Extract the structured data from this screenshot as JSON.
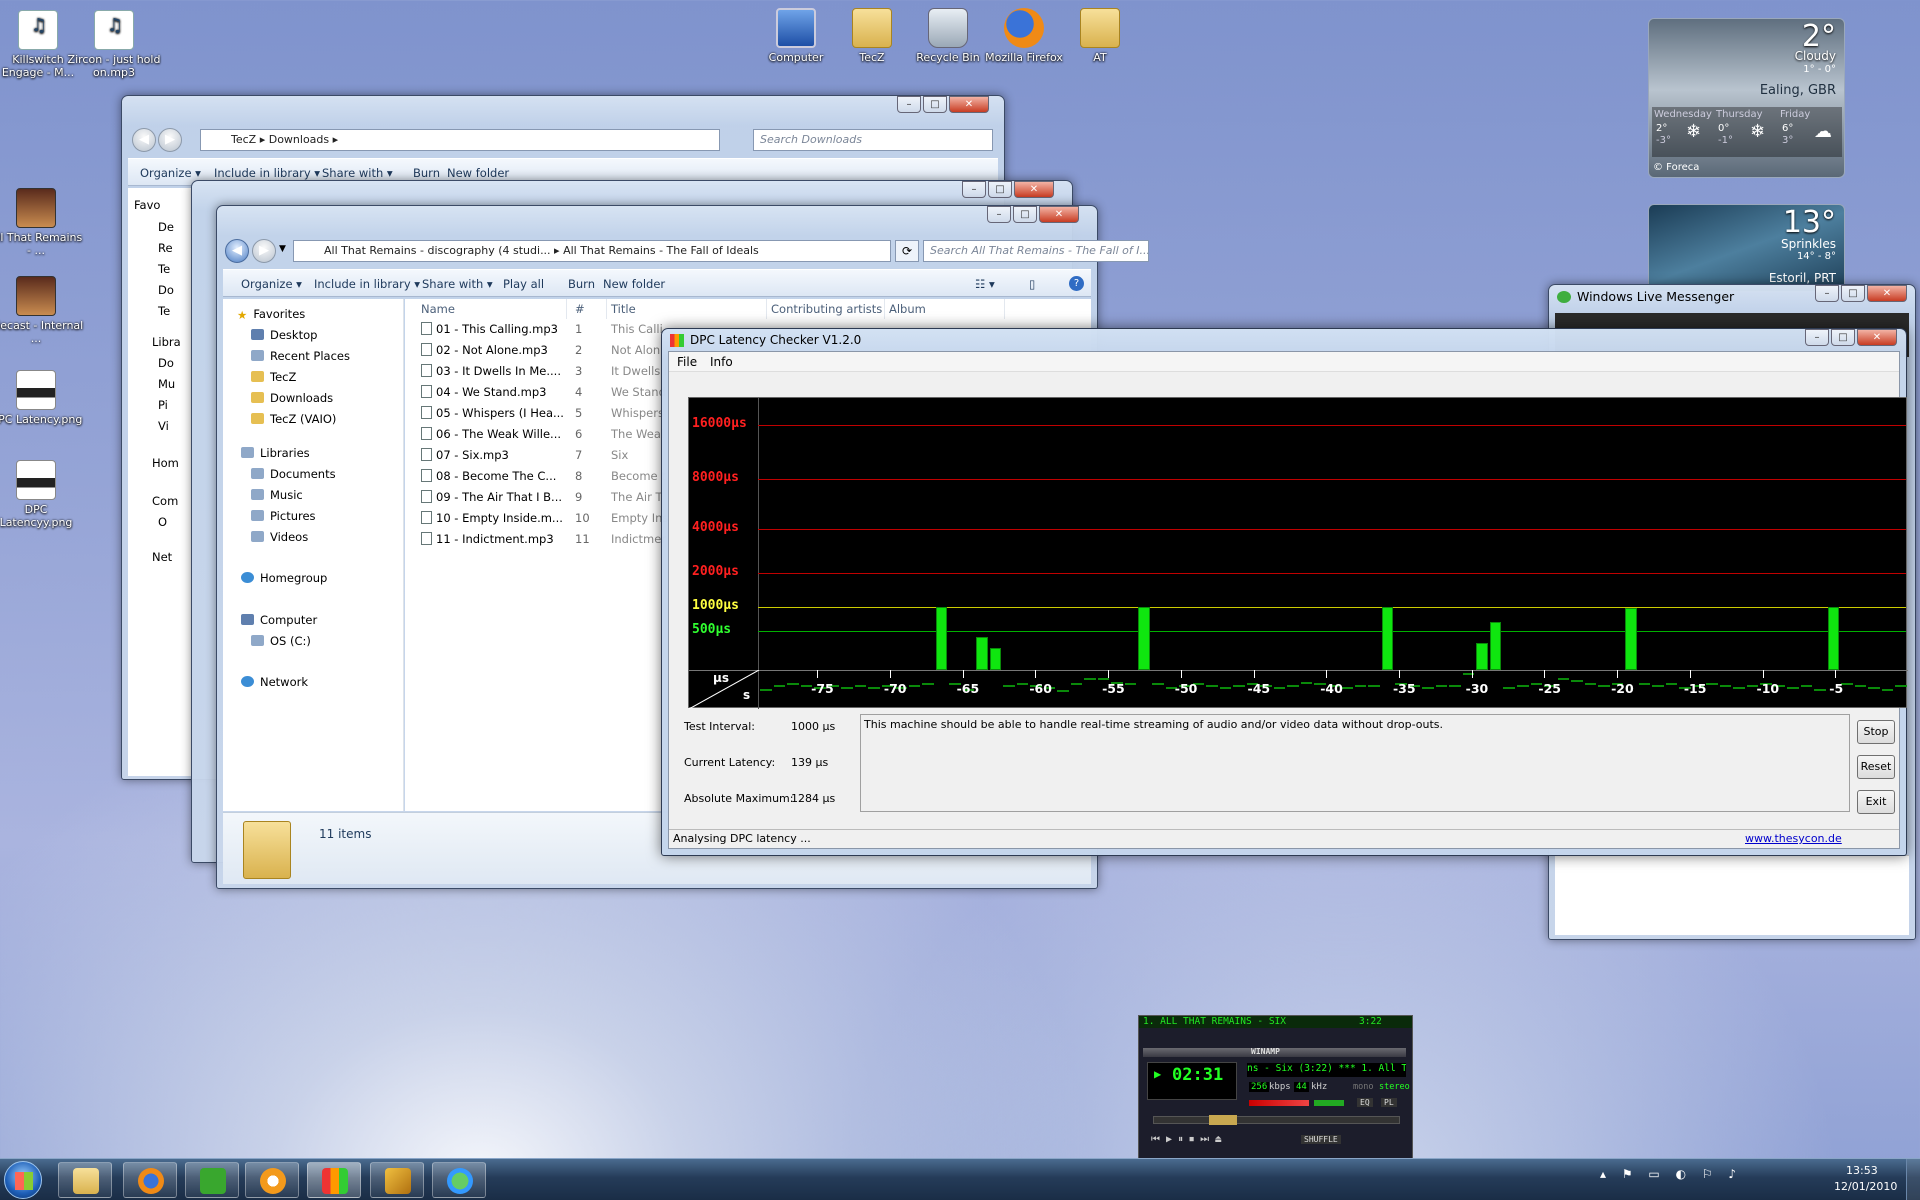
{
  "desktop": {
    "icons": [
      {
        "id": "killswitch",
        "label": "Killswitch Engage - M...",
        "kind": "doc"
      },
      {
        "id": "zircon",
        "label": "Zircon - just hold on.mp3",
        "kind": "doc"
      },
      {
        "id": "computer",
        "label": "Computer",
        "kind": "pc"
      },
      {
        "id": "tecz",
        "label": "TecZ",
        "kind": "folder"
      },
      {
        "id": "recycle",
        "label": "Recycle Bin",
        "kind": "bin"
      },
      {
        "id": "firefox",
        "label": "Mozilla Firefox",
        "kind": "ff"
      },
      {
        "id": "at",
        "label": "AT",
        "kind": "folder"
      },
      {
        "id": "atr",
        "label": "All That Remains - ...",
        "kind": "img"
      },
      {
        "id": "diecast",
        "label": "Diecast - Internal ...",
        "kind": "img"
      },
      {
        "id": "dpc1",
        "label": "DPC Latency.png",
        "kind": "dpcimg"
      },
      {
        "id": "dpc2",
        "label": "DPC Latencyy.png",
        "kind": "dpcimg"
      }
    ]
  },
  "weather1": {
    "temp": "2°",
    "cond": "Cloudy",
    "range": "1° - 0°",
    "loc": "Ealing, GBR",
    "days": [
      {
        "name": "Wednesday",
        "hi": "2°",
        "lo": "-3°"
      },
      {
        "name": "Thursday",
        "hi": "0°",
        "lo": "-1°"
      },
      {
        "name": "Friday",
        "hi": "6°",
        "lo": "3°"
      }
    ],
    "credit": "© Foreca"
  },
  "weather2": {
    "temp": "13°",
    "cond": "Sprinkles",
    "range": "14° - 8°",
    "loc": "Estoril, PRT"
  },
  "explorer1": {
    "crumbs": [
      "TecZ",
      "Downloads"
    ],
    "search": "Search Downloads",
    "toolbar": [
      "Organize ▾",
      "Include in library ▾",
      "Share with ▾",
      "Burn",
      "New folder"
    ],
    "nav_partial": [
      "Favo",
      "De",
      "Re",
      "Te",
      "Do",
      "Te",
      "Libra",
      "Do",
      "Mu",
      "Pi",
      "Vi",
      "Hom",
      "Com",
      "O",
      "Net"
    ]
  },
  "explorer3": {
    "crumbs": [
      "All That Remains - discography (4 studi...",
      "All That Remains - The Fall of Ideals"
    ],
    "search": "Search All That Remains - The Fall of I...",
    "toolbar": [
      "Organize ▾",
      "Include in library ▾",
      "Share with ▾",
      "Play all",
      "Burn",
      "New folder"
    ],
    "nav": {
      "favorites": "Favorites",
      "fav_items": [
        "Desktop",
        "Recent Places",
        "TecZ",
        "Downloads",
        "TecZ (VAIO)"
      ],
      "libraries": "Libraries",
      "lib_items": [
        "Documents",
        "Music",
        "Pictures",
        "Videos"
      ],
      "homegroup": "Homegroup",
      "computer": "Computer",
      "drive": "OS (C:)",
      "network": "Network"
    },
    "columns": [
      "Name",
      "#",
      "Title",
      "Contributing artists",
      "Album"
    ],
    "files": [
      {
        "name": "01 - This Calling.mp3",
        "num": "1",
        "title": "This Calli"
      },
      {
        "name": "02 - Not Alone.mp3",
        "num": "2",
        "title": "Not Alon"
      },
      {
        "name": "03 - It Dwells In Me....",
        "num": "3",
        "title": "It Dwells I"
      },
      {
        "name": "04 - We Stand.mp3",
        "num": "4",
        "title": "We Stand"
      },
      {
        "name": "05 - Whispers (I Hea...",
        "num": "5",
        "title": "Whispers"
      },
      {
        "name": "06 - The Weak Wille...",
        "num": "6",
        "title": "The Weal"
      },
      {
        "name": "07 - Six.mp3",
        "num": "7",
        "title": "Six"
      },
      {
        "name": "08 - Become The C...",
        "num": "8",
        "title": "Become t"
      },
      {
        "name": "09 - The Air That I B...",
        "num": "9",
        "title": "The Air T"
      },
      {
        "name": "10 - Empty Inside.m...",
        "num": "10",
        "title": "Empty Ins"
      },
      {
        "name": "11 - Indictment.mp3",
        "num": "11",
        "title": "Indictmer"
      }
    ],
    "status": "11 items"
  },
  "messenger": {
    "title": "Windows Live Messenger"
  },
  "dpc": {
    "title": "DPC Latency Checker V1.2.0",
    "menu": [
      "File",
      "Info"
    ],
    "labels": {
      "interval": "Test Interval:",
      "current": "Current Latency:",
      "max": "Absolute Maximum:"
    },
    "values": {
      "interval": "1000 µs",
      "current": "139 µs",
      "max": "1284 µs"
    },
    "message": "This machine should be able to handle real-time streaming of audio and/or video data without drop-outs.",
    "buttons": {
      "stop": "Stop",
      "reset": "Reset",
      "exit": "Exit"
    },
    "status": "Analysing DPC latency ...",
    "link": "www.thesycon.de",
    "axis_unit_y": "µs",
    "axis_unit_x": "s"
  },
  "winamp": {
    "title": "1. ALL THAT REMAINS - SIX",
    "dur": "3:22",
    "brand": "WINAMP",
    "time": "02:31",
    "scroll": "ns - Six (3:22) *** 1. All That Re",
    "kbps": "256",
    "khz": "44",
    "kbps_l": "kbps",
    "khz_l": "kHz",
    "mono": "mono",
    "stereo": "stereo",
    "shuffle": "SHUFFLE",
    "eq": "EQ",
    "pl": "PL"
  },
  "taskbar": {
    "time": "13:53",
    "date": "12/01/2010"
  },
  "chart_data": {
    "type": "bar",
    "title": "",
    "xlabel": "s",
    "ylabel": "µs",
    "y_ticks": [
      "16000µs",
      "8000µs",
      "4000µs",
      "2000µs",
      "1000µs",
      "500µs"
    ],
    "x_ticks": [
      "-75",
      "-70",
      "-65",
      "-60",
      "-55",
      "-50",
      "-45",
      "-40",
      "-35",
      "-30",
      "-25",
      "-20",
      "-15",
      "-10",
      "-5"
    ],
    "xlim": [
      -79,
      0
    ],
    "values": [
      95,
      105,
      110,
      105,
      100,
      105,
      100,
      105,
      100,
      105,
      100,
      105,
      110,
      1000,
      110,
      95,
      425,
      305,
      105,
      110,
      105,
      100,
      90,
      110,
      130,
      130,
      115,
      110,
      1000,
      110,
      100,
      105,
      110,
      105,
      100,
      105,
      110,
      105,
      100,
      105,
      115,
      110,
      105,
      100,
      105,
      105,
      1000,
      110,
      105,
      100,
      105,
      105,
      150,
      350,
      650,
      100,
      105,
      110,
      105,
      130,
      120,
      110,
      105,
      110,
      975,
      110,
      105,
      110,
      100,
      105,
      110,
      105,
      100,
      105,
      110,
      105,
      100,
      105,
      95,
      1000,
      110,
      105,
      100,
      95,
      105
    ]
  }
}
